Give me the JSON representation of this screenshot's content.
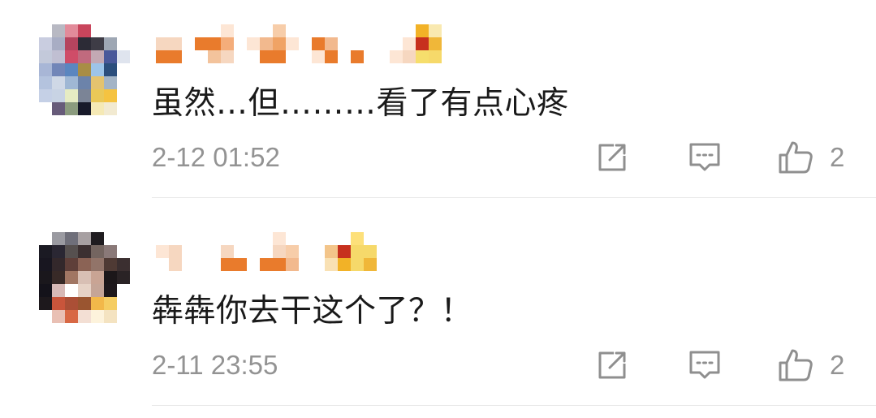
{
  "comments": [
    {
      "text": "虽然…但………看了有点心疼",
      "time": "2-12 01:52",
      "likes": "2",
      "avatar_icon": "blurred-avatar",
      "username_icon": "blurred-username"
    },
    {
      "text": "犇犇你去干这个了？！",
      "time": "2-11 23:55",
      "likes": "2",
      "avatar_icon": "blurred-avatar",
      "username_icon": "blurred-username"
    }
  ],
  "icons": {
    "share": "share-icon",
    "comment": "comment-icon",
    "like": "thumbs-up-icon"
  },
  "colors": {
    "text": "#1a1a1a",
    "meta": "#939393",
    "icon": "#8f8f8f",
    "divider": "#e8e8e8"
  }
}
